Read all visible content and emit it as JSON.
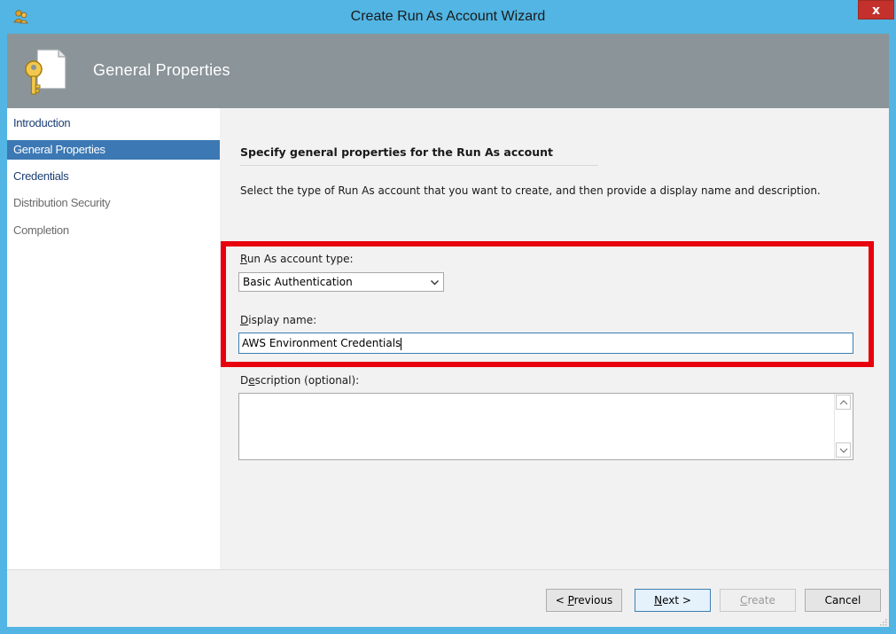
{
  "window": {
    "title": "Create Run As Account Wizard",
    "close_glyph": "x"
  },
  "header": {
    "title": "General Properties",
    "icon": "key-document-icon"
  },
  "sidebar": {
    "items": [
      {
        "label": "Introduction",
        "state": "normal"
      },
      {
        "label": "General Properties",
        "state": "active"
      },
      {
        "label": "Credentials",
        "state": "normal"
      },
      {
        "label": "Distribution Security",
        "state": "disabled"
      },
      {
        "label": "Completion",
        "state": "disabled"
      }
    ]
  },
  "main": {
    "heading": "Specify general properties for the Run As account",
    "intro": "Select the type of Run As account that you want to create, and then provide a display name and description.",
    "account_type": {
      "label_mnemonic": "R",
      "label_rest": "un As account type:",
      "value": "Basic Authentication"
    },
    "display_name": {
      "label_mnemonic": "D",
      "label_rest": "isplay name:",
      "value": "AWS Environment Credentials"
    },
    "description": {
      "label_pre": "D",
      "label_mnemonic": "e",
      "label_rest": "scription (optional):",
      "value": ""
    }
  },
  "footer": {
    "previous": {
      "prefix": "< ",
      "mnemonic": "P",
      "rest": "revious"
    },
    "next": {
      "mnemonic": "N",
      "rest": "ext >"
    },
    "create": {
      "mnemonic": "C",
      "rest": "reate"
    },
    "cancel": "Cancel"
  },
  "colors": {
    "titlebar": "#52b5e3",
    "header_band": "#8a9499",
    "selected_nav": "#3c78b4",
    "highlight": "#e8000c",
    "close_button": "#c4302b"
  }
}
